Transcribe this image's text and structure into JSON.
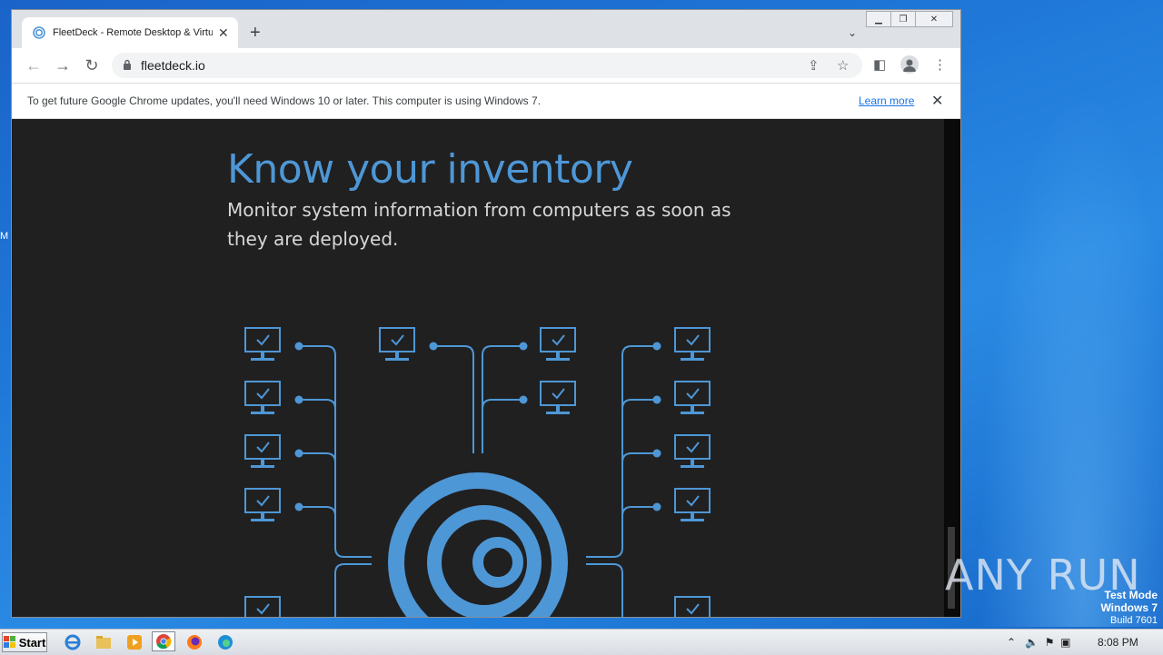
{
  "browser": {
    "tab_title": "FleetDeck - Remote Desktop & Virtual Terminal",
    "url": "fleetdeck.io",
    "window_controls": [
      "minimize",
      "restore",
      "close"
    ]
  },
  "infobar": {
    "message": "To get future Google Chrome updates, you'll need Windows 10 or later. This computer is using Windows 7.",
    "link": "Learn more"
  },
  "page": {
    "title": "Know your inventory",
    "subtitle": "Monitor system information from computers as soon as they are deployed."
  },
  "desktop": {
    "watermark": "ANY RUN",
    "test_mode_line1": "Test Mode",
    "test_mode_line2": "Windows 7",
    "test_mode_line3": "Build 7601",
    "edge_letter": "M"
  },
  "taskbar": {
    "start_label": "Start",
    "clock": "8:08 PM",
    "apps": [
      "internet-explorer",
      "file-explorer",
      "media-player",
      "chrome",
      "firefox",
      "edge"
    ]
  },
  "colors": {
    "page_bg": "#202021",
    "accent": "#4e97d6",
    "text_light": "#d7d7d7"
  }
}
